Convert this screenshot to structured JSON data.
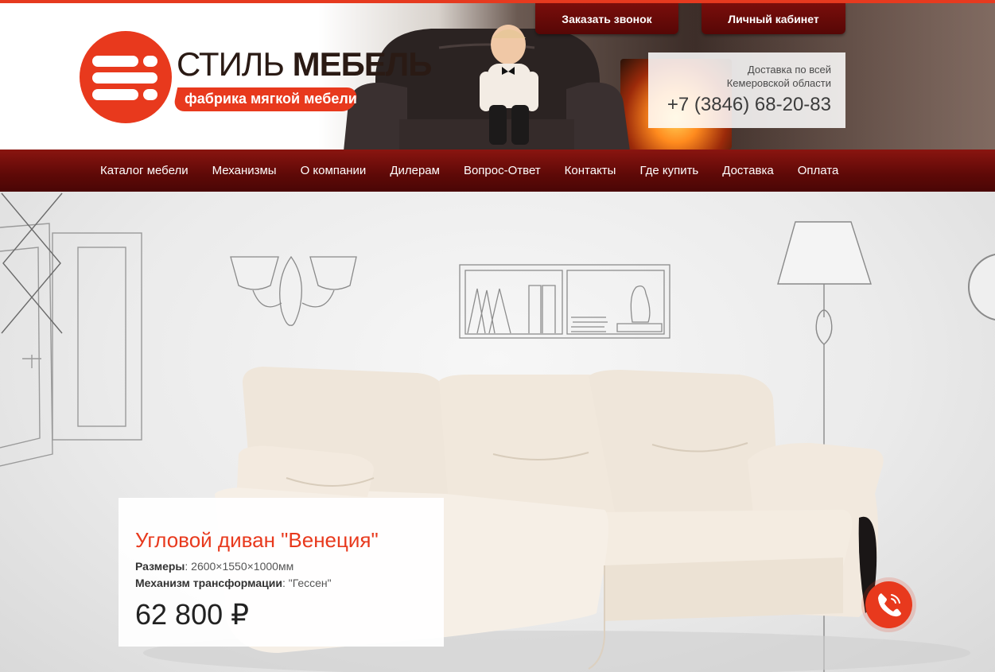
{
  "brand": {
    "name_light": "СТИЛЬ",
    "name_bold": "МЕБЕЛЬ",
    "tagline": "фабрика мягкой мебели",
    "accent_color": "#e8391d",
    "dark_red": "#5e0907"
  },
  "top_buttons": {
    "call": "Заказать звонок",
    "cabinet": "Личный кабинет"
  },
  "contact": {
    "delivery_line1": "Доставка по всей",
    "delivery_line2": "Кемеровской области",
    "phone": "+7 (3846) 68-20-83"
  },
  "nav": {
    "items": [
      {
        "label": "Каталог мебели"
      },
      {
        "label": "Механизмы"
      },
      {
        "label": "О компании"
      },
      {
        "label": "Дилерам"
      },
      {
        "label": "Вопрос-Ответ"
      },
      {
        "label": "Контакты"
      },
      {
        "label": "Где купить"
      },
      {
        "label": "Доставка"
      },
      {
        "label": "Оплата"
      }
    ]
  },
  "slide": {
    "title": "Угловой диван \"Венеция\"",
    "size_label": "Размеры",
    "size_value": ": 2600×1550×1000мм",
    "mechanism_label": "Механизм трансформации",
    "mechanism_value": ": \"Гессен\"",
    "price": "62 800 ₽"
  },
  "icons": {
    "prev": "chevron-left-icon",
    "next": "chevron-right-icon",
    "call": "phone-icon"
  }
}
